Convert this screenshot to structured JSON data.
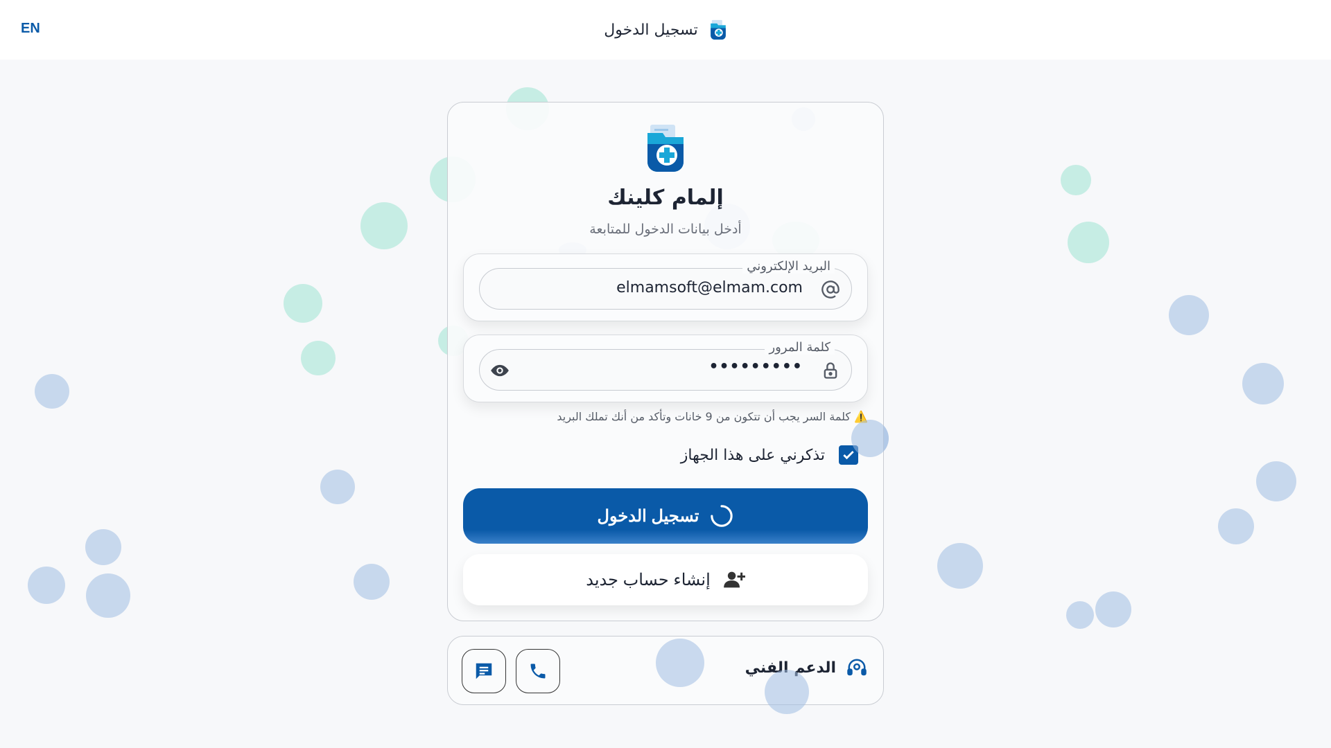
{
  "header": {
    "language_toggle": "EN",
    "title": "تسجيل الدخول"
  },
  "brand": {
    "name": "إلمام كلينك",
    "subtitle": "أدخل بيانات الدخول للمتابعة",
    "primary_color": "#0a5aa8",
    "accent_color": "#1aa7d8"
  },
  "form": {
    "email": {
      "label": "البريد الإلكتروني",
      "value": "elmamsoft@elmam.com",
      "icon": "at-icon"
    },
    "password": {
      "label": "كلمة المرور",
      "value": "•••••••••",
      "icon": "lock-icon",
      "toggle_icon": "eye-icon"
    },
    "hint": "⚠️ كلمة السر يجب أن تتكون من 9 خانات وتأكد من أنك تملك البريد",
    "remember": {
      "label": "تذكرني على هذا الجهاز",
      "checked": true
    },
    "login_button": "تسجيل الدخول",
    "register_button": "إنشاء حساب جديد"
  },
  "support": {
    "title": "الدعم الفني",
    "actions": [
      "phone-icon",
      "chat-icon"
    ]
  }
}
